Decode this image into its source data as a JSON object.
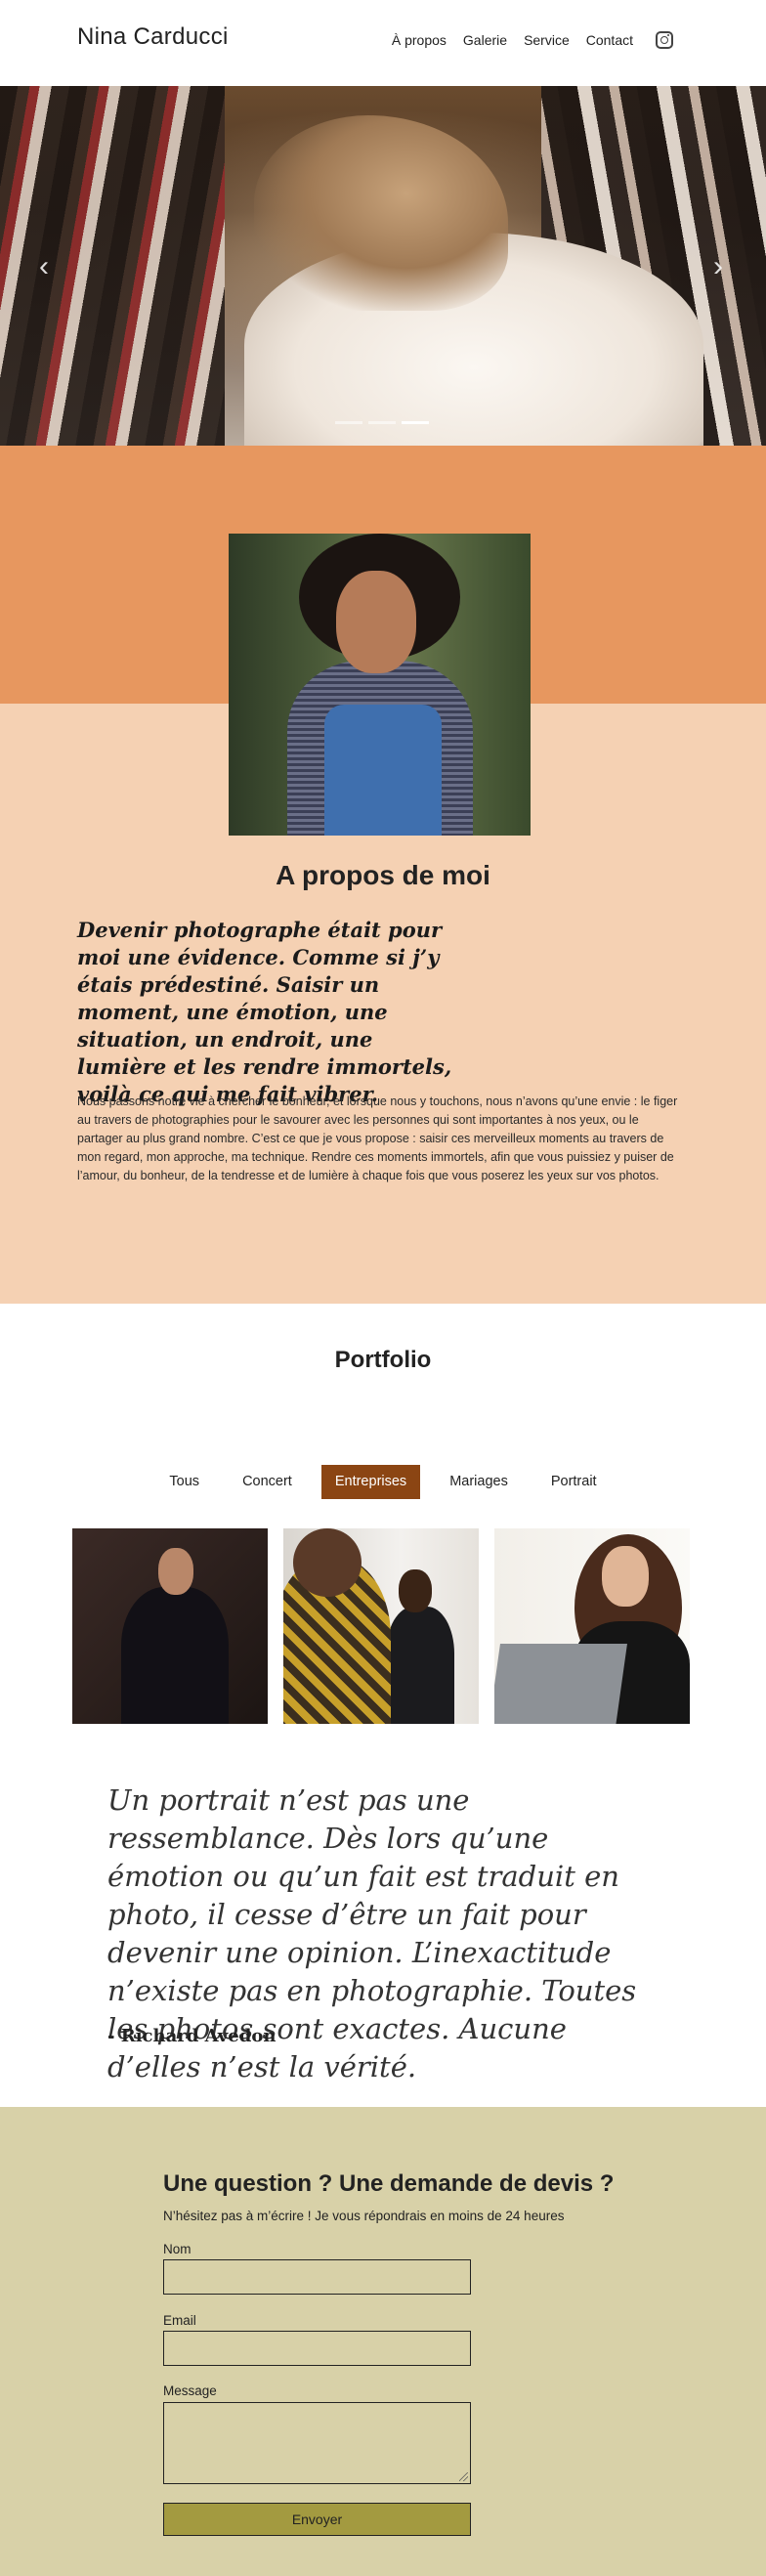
{
  "header": {
    "site_name": "Nina Carducci",
    "nav": [
      "À propos",
      "Galerie",
      "Service",
      "Contact"
    ],
    "instagram_icon": "instagram-icon"
  },
  "hero": {
    "slide_count": 3,
    "active_slide": 3
  },
  "about": {
    "title": "A propos de moi",
    "quote": "Devenir photographe était pour moi une évidence. Comme si j’y étais prédestiné. Saisir un moment, une émotion, une situation, un endroit, une lumière et les rendre immortels, voilà ce qui me fait vibrer.",
    "body": "Nous passons notre vie à chercher le bonheur, et lorsque nous y touchons, nous n’avons qu’une envie : le figer au travers de photographies pour le savourer avec les personnes qui sont importantes à nos yeux, ou le partager au plus grand nombre. C’est ce que je vous propose : saisir ces merveilleux moments au travers de mon regard, mon approche, ma technique. Rendre ces moments immortels, afin que vous puissiez y puiser de l’amour, du bonheur, de la tendresse et de lumière à chaque fois que vous poserez les yeux sur vos photos."
  },
  "portfolio": {
    "title": "Portfolio",
    "filters": [
      "Tous",
      "Concert",
      "Entreprises",
      "Mariages",
      "Portrait"
    ],
    "active_filter": "Entreprises"
  },
  "quote": {
    "text": "Un portrait n’est pas une ressemblance. Dès lors qu’une émotion ou qu’un fait est traduit en photo, il cesse d’être un fait pour devenir une opinion. L’inexactitude n’existe pas en photographie. Toutes les photos sont exactes. Aucune d’elles n’est la vérité.",
    "author": "- Richard Avedon"
  },
  "contact": {
    "title": "Une question ? Une demande de devis ?",
    "subtitle": "N’hésitez pas à m’écrire ! Je vous répondrais en moins de 24 heures",
    "name_label": "Nom",
    "email_label": "Email",
    "message_label": "Message",
    "name_value": "",
    "email_value": "",
    "message_value": "",
    "submit_label": "Envoyer"
  },
  "colors": {
    "about_top": "#e7975f",
    "about_bg": "#f5d1b3",
    "filter_active": "#8b4513",
    "contact_bg": "#d8d1a8",
    "submit_bg": "#a39a40"
  }
}
